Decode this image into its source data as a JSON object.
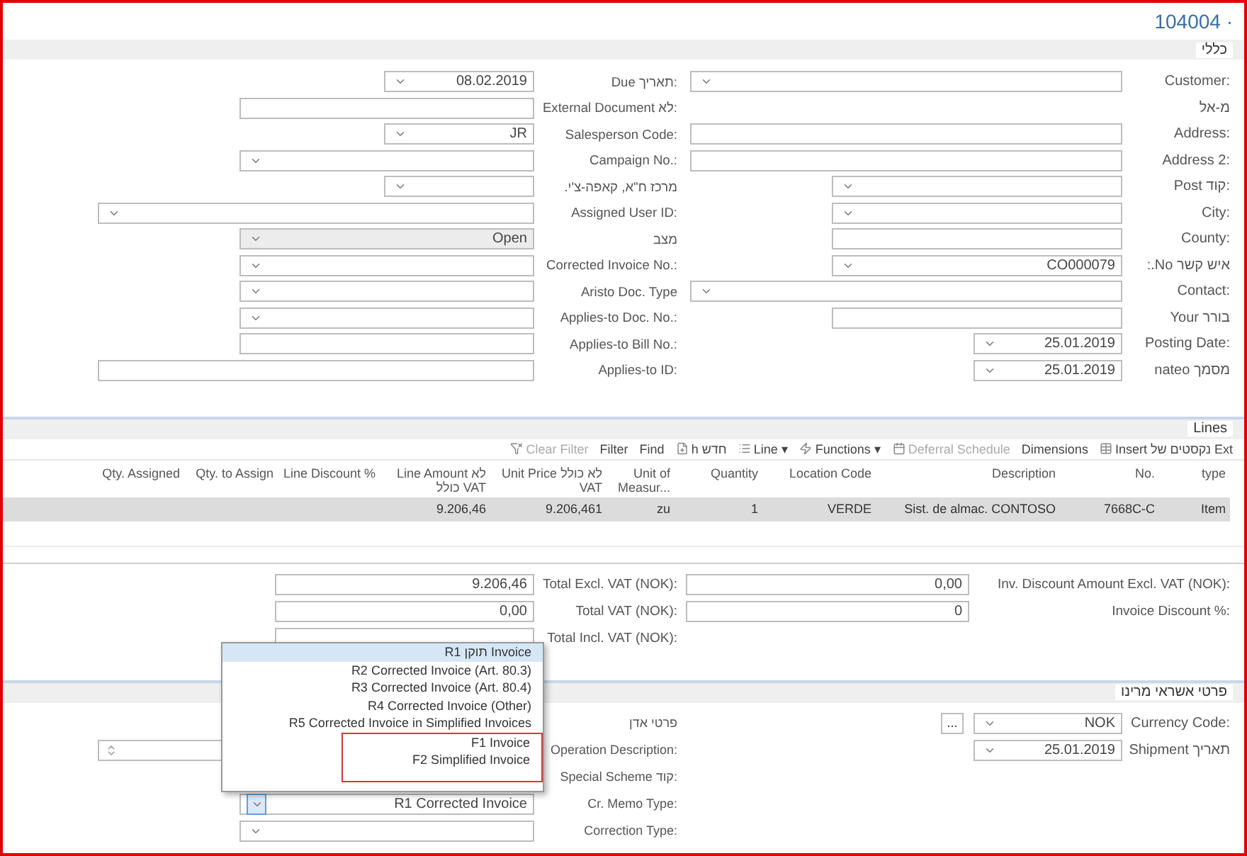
{
  "title": "104004 ·",
  "general": {
    "heading": "כללי",
    "right": [
      {
        "label": "Customer:",
        "field": {
          "kind": "dropdown",
          "disabled": false
        }
      },
      {
        "label": "מ-אל"
      },
      {
        "label": "Address:",
        "field": {
          "kind": "text",
          "disabled": false
        }
      },
      {
        "label": "Address 2:",
        "field": {
          "kind": "text",
          "disabled": false
        }
      },
      {
        "label": "Post קוד:",
        "field": {
          "kind": "dropdown",
          "disabled": false
        }
      },
      {
        "label": "City:",
        "field": {
          "kind": "dropdown",
          "disabled": false
        }
      },
      {
        "label": "County:",
        "field": {
          "kind": "text",
          "disabled": false
        }
      },
      {
        "label": "איש קשר No.:",
        "field": {
          "kind": "dropdown",
          "value": "CO000079",
          "disabled": false
        }
      },
      {
        "label": "Contact:",
        "field": {
          "kind": "dropdown",
          "disabled": false
        }
      },
      {
        "label": "Your בורר",
        "field": {
          "kind": "text",
          "disabled": false
        }
      },
      {
        "label": "Posting Date:",
        "field": {
          "kind": "dropdown",
          "value": "25.01.2019",
          "disabled": false
        }
      },
      {
        "label": "מסמך nateo",
        "field": {
          "kind": "dropdown",
          "value": "25.01.2019",
          "disabled": false
        }
      }
    ],
    "left": [
      {
        "label": "Due תאריך:",
        "field": {
          "kind": "dropdown",
          "value": "08.02.2019",
          "disabled": false
        }
      },
      {
        "label": "External Document לא:",
        "field": {
          "kind": "text",
          "disabled": false
        }
      },
      {
        "label": "Salesperson Code:",
        "field": {
          "kind": "dropdown",
          "value": "JR",
          "disabled": false
        }
      },
      {
        "label": "Campaign No.:",
        "field": {
          "kind": "dropdown",
          "disabled": false
        }
      },
      {
        "label": "מרכז ח\"א, קאפה-צ'י.",
        "field": {
          "kind": "dropdown",
          "disabled": false
        }
      },
      {
        "label": "Assigned User ID:",
        "field": {
          "kind": "dropdown",
          "disabled": false
        }
      },
      {
        "label": "מצב",
        "field": {
          "kind": "dropdown",
          "value": "Open",
          "disabled": true
        }
      },
      {
        "label": "Corrected Invoice No.:",
        "field": {
          "kind": "dropdown",
          "disabled": false
        }
      },
      {
        "label": "Aristo Doc. Type",
        "field": {
          "kind": "dropdown",
          "disabled": false
        }
      },
      {
        "label": "Applies-to Doc. No.:",
        "field": {
          "kind": "dropdown",
          "disabled": false
        }
      },
      {
        "label": "Applies-to Bill No.:",
        "field": {
          "kind": "text",
          "disabled": false
        }
      },
      {
        "label": "Applies-to ID:",
        "field": {
          "kind": "text",
          "disabled": false
        }
      }
    ]
  },
  "lines": {
    "heading": "Lines",
    "toolbar": [
      {
        "label": "Clear Filter",
        "disabled": true
      },
      {
        "label": "Filter",
        "disabled": false
      },
      {
        "label": "Find",
        "disabled": false
      },
      {
        "label": "h חדש",
        "disabled": false
      },
      {
        "label": "Line ▾",
        "disabled": false
      },
      {
        "label": "Functions ▾",
        "disabled": false
      },
      {
        "label": "Deferral Schedule",
        "disabled": true
      },
      {
        "label": "Dimensions",
        "disabled": false
      },
      {
        "label": "Insert נקסטים של Ext",
        "disabled": false
      }
    ],
    "columns": [
      "Qty. Assigned",
      "Qty. to Assign",
      "Line Discount %",
      "Line Amount לא כולל VAT",
      "Unit Price לא כולל VAT",
      "Unit of Measur...",
      "Quantity",
      "Location Code",
      "Description",
      "No.",
      "type"
    ],
    "rows": [
      {
        "selected": true,
        "cells": [
          "",
          "",
          "",
          "9.206,46",
          "9.206,461",
          "zu",
          "1",
          "VERDE",
          "Sist. de almac. CONTOSO",
          "7668C-C",
          "Item"
        ]
      }
    ]
  },
  "totals": {
    "right": [
      {
        "label": "Inv. Discount Amount Excl. VAT (NOK):",
        "field": {
          "kind": "text",
          "value": "0,00",
          "disabled": false
        }
      },
      {
        "label": "Invoice Discount %:",
        "field": {
          "kind": "text",
          "value": "0",
          "disabled": false
        }
      }
    ],
    "left": [
      {
        "label": "Total Excl. VAT (NOK):",
        "field": {
          "kind": "text",
          "value": "9.206,46",
          "disabled": false
        }
      },
      {
        "label": "Total VAT (NOK):",
        "field": {
          "kind": "text",
          "value": "0,00",
          "disabled": false
        }
      },
      {
        "label": "Total Incl. VAT (NOK):",
        "field": {
          "kind": "text",
          "disabled": false
        }
      }
    ]
  },
  "payment": {
    "heading": "פרטי אשראי מרינו",
    "right": [
      {
        "label": "Currency Code:",
        "field": {
          "kind": "lookup",
          "value": "NOK",
          "button": "...",
          "disabled": false,
          "focused": false
        }
      },
      {
        "label": "Shipment תאריך",
        "field": {
          "kind": "dropdown",
          "value": "25.01.2019",
          "disabled": false,
          "focused": false
        }
      }
    ],
    "left": [
      {
        "label": "פרטי אדן"
      },
      {
        "label": "Operation Description:",
        "field": {
          "kind": "spinner",
          "disabled": false,
          "focused": false
        }
      },
      {
        "label": "Special Scheme קוד:"
      },
      {
        "label": "Cr. Memo Type:",
        "field": {
          "kind": "dropdown",
          "value": "R1 Corrected Invoice",
          "disabled": false,
          "focused": true
        }
      },
      {
        "label": "Correction Type:",
        "field": {
          "kind": "dropdown",
          "disabled": false,
          "focused": false
        }
      }
    ]
  },
  "dropdown_options": [
    {
      "label": "R1 תוקן Invoice",
      "selected": true,
      "marked": false
    },
    {
      "label": "R2 Corrected Invoice (Art. 80.3)",
      "selected": false,
      "marked": false
    },
    {
      "label": "R3 Corrected Invoice (Art. 80.4)",
      "selected": false,
      "marked": false
    },
    {
      "label": "R4 Corrected Invoice (Other)",
      "selected": false,
      "marked": false
    },
    {
      "label": "R5 Corrected Invoice in Simplified Invoices",
      "selected": false,
      "marked": false
    },
    {
      "label": "F1 Invoice",
      "selected": false,
      "marked": true
    },
    {
      "label": "F2 Simplified Invoice",
      "selected": false,
      "marked": true
    }
  ]
}
